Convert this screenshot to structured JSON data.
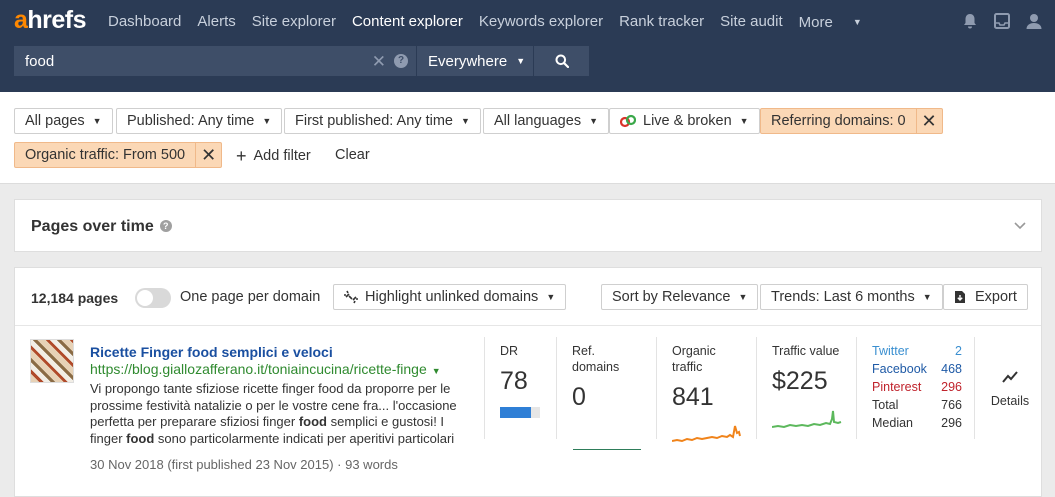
{
  "app": {
    "logo_a": "a",
    "logo_rest": "hrefs"
  },
  "nav": {
    "items": [
      "Dashboard",
      "Alerts",
      "Site explorer",
      "Content explorer",
      "Keywords explorer",
      "Rank tracker",
      "Site audit",
      "More"
    ],
    "active": "Content explorer"
  },
  "search": {
    "value": "food",
    "mode": "Everywhere"
  },
  "filters": {
    "all_pages": "All pages",
    "published": "Published: Any time",
    "first_published": "First published: Any time",
    "languages": "All languages",
    "live_broken": "Live & broken",
    "referring_domains": "Referring domains: 0",
    "organic_traffic": "Organic traffic: From 500",
    "add_filter": "Add filter",
    "clear": "Clear"
  },
  "pages_over_time": {
    "title": "Pages over time"
  },
  "results": {
    "count": "12,184 pages",
    "one_per_domain": "One page per domain",
    "one_per_domain_on": false,
    "highlight": "Highlight unlinked domains",
    "sort": "Sort by Relevance",
    "trends": "Trends: Last 6 months",
    "export": "Export"
  },
  "result": {
    "title": "Ricette Finger food semplici e veloci",
    "url": "https://blog.giallozafferano.it/toniaincucina/ricette-finge",
    "snippet": [
      {
        "t": "Vi propongo tante sfiziose ricette finger food da proporre per le prossime festività natalizie o per le vostre cene fra... l'occasione perfetta per preparare sfiziosi finger "
      },
      {
        "b": "food"
      },
      {
        "t": " semplici e gustosi! I finger "
      },
      {
        "b": "food"
      },
      {
        "t": " sono particolarmente indicati  per aperitivi particolari"
      }
    ],
    "date": "30 Nov 2018 (first published 23 Nov 2015)",
    "words": "93 words",
    "dr_label": "DR",
    "dr": "78",
    "dr_fraction": 0.78,
    "ref_label": "Ref. domains",
    "ref": "0",
    "organic_label": "Organic traffic",
    "organic": "841",
    "value_label": "Traffic value",
    "value": "$225",
    "social": [
      {
        "name": "Twitter",
        "count": "2",
        "color": "#3a8fd0",
        "count_color": "#3a8fd0"
      },
      {
        "name": "Facebook",
        "count": "468",
        "color": "#1f5aa6",
        "count_color": "#1f5aa6"
      },
      {
        "name": "Pinterest",
        "count": "296",
        "color": "#c0232c",
        "count_color": "#c0232c"
      },
      {
        "name": "Total",
        "count": "766",
        "color": "#333333",
        "count_color": "#333333"
      },
      {
        "name": "Median",
        "count": "296",
        "color": "#333333",
        "count_color": "#333333"
      }
    ],
    "details": "Details"
  },
  "colors": {
    "topbar": "#2b3b55",
    "accent": "#ff8800",
    "link": "#1a4fa0",
    "url": "#2f8a2f",
    "dr_bar": "#2f7fd6",
    "organic_spark": "#f0831a",
    "value_spark": "#5cb85c"
  }
}
